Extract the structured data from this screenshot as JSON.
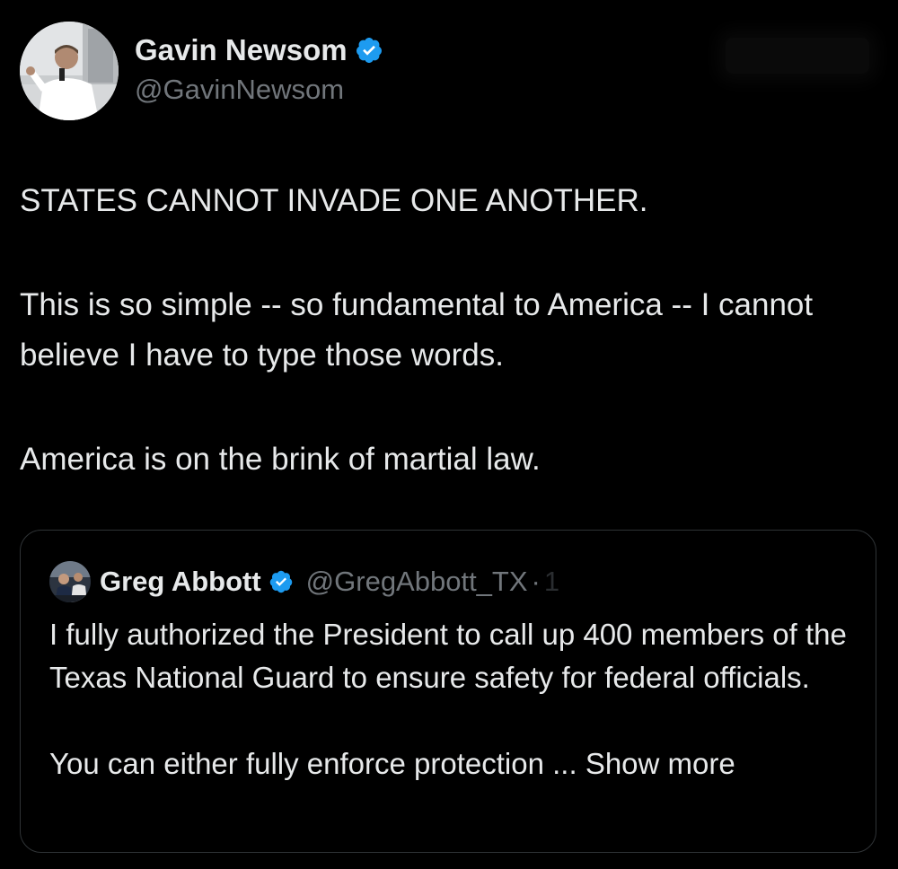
{
  "tweet": {
    "author": {
      "display_name": "Gavin Newsom",
      "handle": "@GavinNewsom",
      "verified_icon": "verified-badge-icon",
      "avatar_icon": "profile-photo"
    },
    "paragraphs": [
      "STATES CANNOT INVADE ONE ANOTHER.",
      "This is so simple -- so fundamental to America -- I cannot believe I have to type those words.",
      "America is on the brink of martial law."
    ]
  },
  "quoted_tweet": {
    "author": {
      "display_name": "Greg Abbott",
      "handle": "@GregAbbott_TX",
      "separator": "·",
      "time_fragment": "1",
      "verified_icon": "verified-badge-icon",
      "avatar_icon": "profile-photo"
    },
    "paragraphs": [
      "I fully authorized the President to call up 400 members of the Texas National Guard to ensure safety for federal officials.",
      "You can either fully enforce protection ... "
    ],
    "show_more_label": "Show more"
  },
  "colors": {
    "background": "#000000",
    "primary_text": "#e7e9ea",
    "secondary_text": "#71767b",
    "verified_blue": "#1d9bf0",
    "quote_border": "#2f3336"
  }
}
